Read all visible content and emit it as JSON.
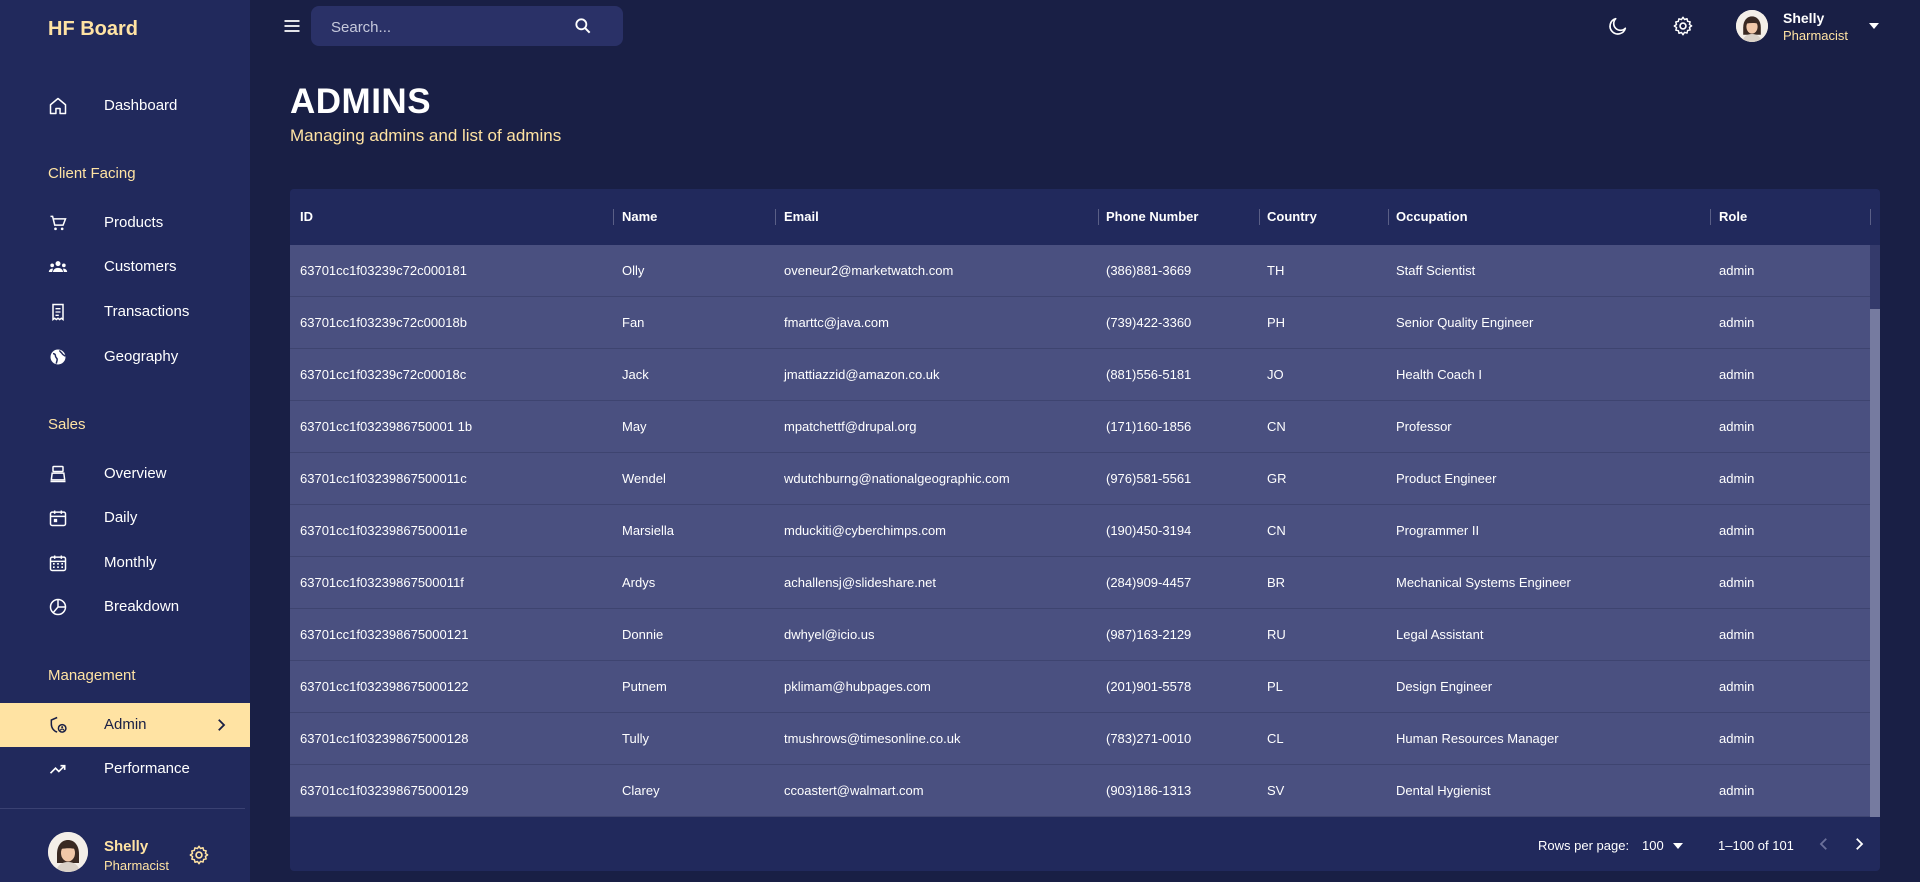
{
  "brand": "HF Board",
  "sidebar": {
    "sections": {
      "client_facing": "Client Facing",
      "sales": "Sales",
      "management": "Management"
    },
    "items": [
      {
        "label": "Dashboard",
        "icon": "home-icon"
      },
      {
        "label": "Products",
        "icon": "cart-icon"
      },
      {
        "label": "Customers",
        "icon": "group-icon"
      },
      {
        "label": "Transactions",
        "icon": "receipt-icon"
      },
      {
        "label": "Geography",
        "icon": "globe-icon"
      },
      {
        "label": "Overview",
        "icon": "point-of-sale-icon"
      },
      {
        "label": "Daily",
        "icon": "calendar-day-icon"
      },
      {
        "label": "Monthly",
        "icon": "calendar-month-icon"
      },
      {
        "label": "Breakdown",
        "icon": "pie-chart-icon"
      },
      {
        "label": "Admin",
        "icon": "admin-icon",
        "active": true
      },
      {
        "label": "Performance",
        "icon": "trending-up-icon"
      }
    ],
    "user": {
      "name": "Shelly",
      "role": "Pharmacist"
    }
  },
  "topbar": {
    "search_placeholder": "Search...",
    "user": {
      "name": "Shelly",
      "role": "Pharmacist"
    }
  },
  "page": {
    "title": "ADMINS",
    "subtitle": "Managing admins and list of admins"
  },
  "table": {
    "columns": [
      "ID",
      "Name",
      "Email",
      "Phone Number",
      "Country",
      "Occupation",
      "Role"
    ],
    "rows": [
      [
        "63701cc1f03239c72c000181",
        "Olly",
        "oveneur2@marketwatch.com",
        "(386)881-3669",
        "TH",
        "Staff Scientist",
        "admin"
      ],
      [
        "63701cc1f03239c72c00018b",
        "Fan",
        "fmarttc@java.com",
        "(739)422-3360",
        "PH",
        "Senior Quality Engineer",
        "admin"
      ],
      [
        "63701cc1f03239c72c00018c",
        "Jack",
        "jmattiazzid@amazon.co.uk",
        "(881)556-5181",
        "JO",
        "Health Coach I",
        "admin"
      ],
      [
        "63701cc1f0323986750001 1b",
        "May",
        "mpatchettf@drupal.org",
        "(171)160-1856",
        "CN",
        "Professor",
        "admin"
      ],
      [
        "63701cc1f03239867500011c",
        "Wendel",
        "wdutchburng@nationalgeographic.com",
        "(976)581-5561",
        "GR",
        "Product Engineer",
        "admin"
      ],
      [
        "63701cc1f03239867500011e",
        "Marsiella",
        "mduckiti@cyberchimps.com",
        "(190)450-3194",
        "CN",
        "Programmer II",
        "admin"
      ],
      [
        "63701cc1f03239867500011f",
        "Ardys",
        "achallensj@slideshare.net",
        "(284)909-4457",
        "BR",
        "Mechanical Systems Engineer",
        "admin"
      ],
      [
        "63701cc1f032398675000121",
        "Donnie",
        "dwhyel@icio.us",
        "(987)163-2129",
        "RU",
        "Legal Assistant",
        "admin"
      ],
      [
        "63701cc1f032398675000122",
        "Putnem",
        "pklimam@hubpages.com",
        "(201)901-5578",
        "PL",
        "Design Engineer",
        "admin"
      ],
      [
        "63701cc1f032398675000128",
        "Tully",
        "tmushrows@timesonline.co.uk",
        "(783)271-0010",
        "CL",
        "Human Resources Manager",
        "admin"
      ],
      [
        "63701cc1f032398675000129",
        "Clarey",
        "ccoastert@walmart.com",
        "(903)186-1313",
        "SV",
        "Dental Hygienist",
        "admin"
      ]
    ],
    "footer": {
      "rows_per_page_label": "Rows per page:",
      "rows_per_page_value": "100",
      "range": "1–100 of 101"
    }
  }
}
